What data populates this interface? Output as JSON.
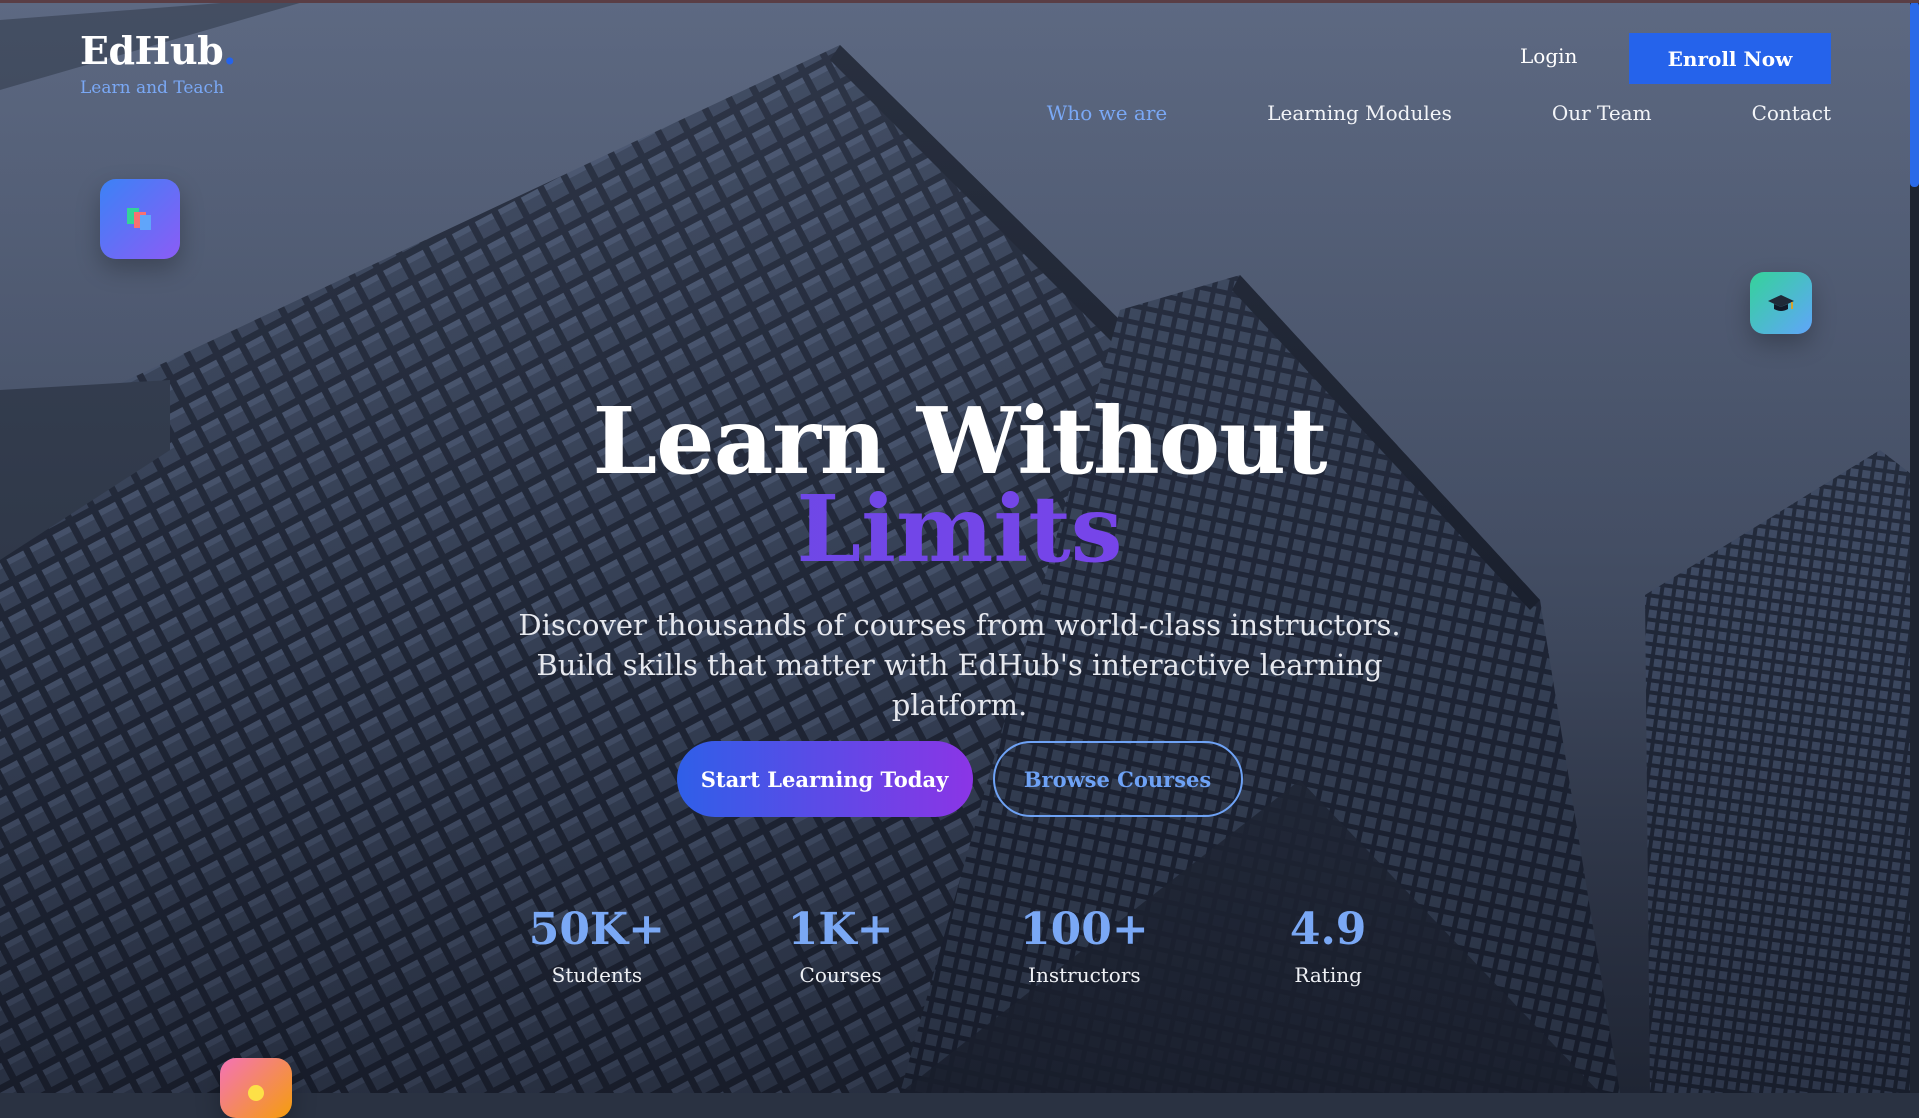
{
  "brand": {
    "name": "EdHub",
    "dot": ".",
    "tagline": "Learn and Teach"
  },
  "header": {
    "login_label": "Login",
    "enroll_label": "Enroll Now",
    "nav": [
      {
        "label": "Who we are",
        "active": true
      },
      {
        "label": "Learning Modules",
        "active": false
      },
      {
        "label": "Our Team",
        "active": false
      },
      {
        "label": "Contact",
        "active": false
      }
    ]
  },
  "hero": {
    "title_line1": "Learn Without",
    "title_line2": "Limits",
    "subtitle": "Discover thousands of courses from world-class instructors. Build skills that matter with EdHub's interactive learning platform.",
    "primary_cta": "Start Learning Today",
    "secondary_cta": "Browse Courses"
  },
  "stats": [
    {
      "value": "50K+",
      "label": "Students"
    },
    {
      "value": "1K+",
      "label": "Courses"
    },
    {
      "value": "100+",
      "label": "Instructors"
    },
    {
      "value": "4.9",
      "label": "Rating"
    }
  ],
  "floating_icons": [
    "books-icon",
    "graduation-cap-icon",
    "lightbulb-icon"
  ],
  "colors": {
    "accent_blue": "#2563eb",
    "link_blue": "#7aa8f5",
    "gradient_start": "#2f5fe8",
    "gradient_end": "#8b35e6"
  }
}
